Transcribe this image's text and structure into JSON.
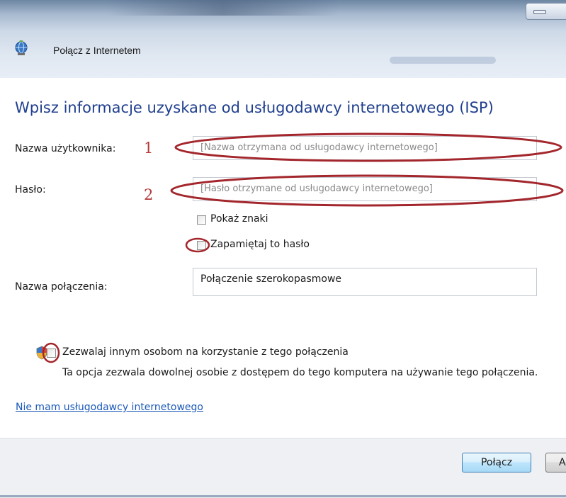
{
  "window": {
    "title": "Połącz z Internetem"
  },
  "heading": "Wpisz informacje uzyskane od usługodawcy internetowego (ISP)",
  "form": {
    "username": {
      "label": "Nazwa użytkownika:",
      "placeholder": "[Nazwa otrzymana od usługodawcy internetowego]",
      "marker": "1"
    },
    "password": {
      "label": "Hasło:",
      "placeholder": "[Hasło otrzymane od usługodawcy internetowego]",
      "marker": "2"
    },
    "show_chars": {
      "label": "Pokaż znaki",
      "checked": false
    },
    "remember": {
      "label": "Zapamiętaj to hasło",
      "checked": false
    },
    "connection_name": {
      "label": "Nazwa połączenia:",
      "value": "Połączenie szerokopasmowe"
    }
  },
  "allow_others": {
    "label": "Zezwalaj innym osobom na korzystanie z tego połączenia",
    "description": "Ta opcja zezwala dowolnej osobie z dostępem do tego komputera na używanie tego połączenia.",
    "checked": false
  },
  "no_isp_link": "Nie mam usługodawcy internetowego",
  "buttons": {
    "connect": "Połącz",
    "cancel": "Anuluj"
  },
  "colors": {
    "heading": "#1f3f8e",
    "link": "#1a59b8",
    "annotation": "#b23a3a"
  },
  "icons": {
    "window": "network-globe-icon",
    "uac": "uac-shield-icon"
  }
}
